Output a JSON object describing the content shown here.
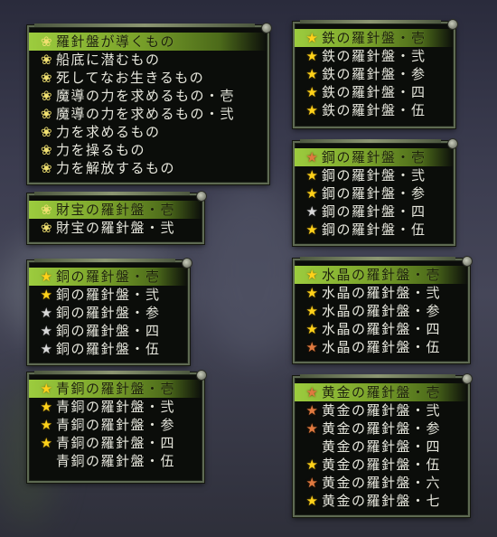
{
  "colors": {
    "selected_row": "#8fbf34",
    "panel_border": "#5e6a52",
    "panel_bg": "#0b0d0a",
    "star_gold": "#ffd21a",
    "star_silver": "#d8d8d8",
    "star_bronze": "#e07a40",
    "flower": "#f0e070"
  },
  "panels": {
    "mission": {
      "items": [
        {
          "label": "羅針盤が導くもの",
          "icon": "flower-icon",
          "selected": true
        },
        {
          "label": "船底に潜むもの",
          "icon": "flower-icon"
        },
        {
          "label": "死してなお生きるもの",
          "icon": "flower-icon"
        },
        {
          "label": "魔導の力を求めるもの・壱",
          "icon": "flower-icon"
        },
        {
          "label": "魔導の力を求めるもの・弐",
          "icon": "flower-icon"
        },
        {
          "label": "力を求めるもの",
          "icon": "flower-icon"
        },
        {
          "label": "力を操るもの",
          "icon": "flower-icon"
        },
        {
          "label": "力を解放するもの",
          "icon": "flower-icon"
        }
      ]
    },
    "zaiho": {
      "items": [
        {
          "label": "財宝の羅針盤・壱",
          "icon": "flower-icon",
          "selected": true
        },
        {
          "label": "財宝の羅針盤・弐",
          "icon": "flower-icon"
        }
      ]
    },
    "do": {
      "items": [
        {
          "label": "銅の羅針盤・壱",
          "icon": "star-gold-icon",
          "selected": true
        },
        {
          "label": "銅の羅針盤・弐",
          "icon": "star-gold-icon"
        },
        {
          "label": "銅の羅針盤・参",
          "icon": "star-silver-icon"
        },
        {
          "label": "銅の羅針盤・四",
          "icon": "star-silver-icon"
        },
        {
          "label": "銅の羅針盤・伍",
          "icon": "star-silver-icon"
        }
      ]
    },
    "seido": {
      "items": [
        {
          "label": "青銅の羅針盤・壱",
          "icon": "star-gold-icon",
          "selected": true
        },
        {
          "label": "青銅の羅針盤・弐",
          "icon": "star-gold-icon"
        },
        {
          "label": "青銅の羅針盤・参",
          "icon": "star-gold-icon"
        },
        {
          "label": "青銅の羅針盤・四",
          "icon": "star-gold-icon"
        },
        {
          "label": "青銅の羅針盤・伍",
          "icon": ""
        }
      ]
    },
    "tetsu": {
      "items": [
        {
          "label": "鉄の羅針盤・壱",
          "icon": "star-gold-icon",
          "selected": true
        },
        {
          "label": "鉄の羅針盤・弐",
          "icon": "star-gold-icon"
        },
        {
          "label": "鉄の羅針盤・参",
          "icon": "star-gold-icon"
        },
        {
          "label": "鉄の羅針盤・四",
          "icon": "star-gold-icon"
        },
        {
          "label": "鉄の羅針盤・伍",
          "icon": "star-gold-icon"
        }
      ]
    },
    "ko": {
      "items": [
        {
          "label": "鋼の羅針盤・壱",
          "icon": "star-bronze-icon",
          "selected": true
        },
        {
          "label": "鋼の羅針盤・弐",
          "icon": "star-gold-icon"
        },
        {
          "label": "鋼の羅針盤・参",
          "icon": "star-gold-icon"
        },
        {
          "label": "鋼の羅針盤・四",
          "icon": "star-silver-icon"
        },
        {
          "label": "鋼の羅針盤・伍",
          "icon": "star-gold-icon"
        }
      ]
    },
    "suisho": {
      "items": [
        {
          "label": "水晶の羅針盤・壱",
          "icon": "star-gold-icon",
          "selected": true
        },
        {
          "label": "水晶の羅針盤・弐",
          "icon": "star-gold-icon"
        },
        {
          "label": "水晶の羅針盤・参",
          "icon": "star-gold-icon"
        },
        {
          "label": "水晶の羅針盤・四",
          "icon": "star-gold-icon"
        },
        {
          "label": "水晶の羅針盤・伍",
          "icon": "star-bronze-icon"
        }
      ]
    },
    "ogon": {
      "items": [
        {
          "label": "黄金の羅針盤・壱",
          "icon": "star-bronze-icon",
          "selected": true
        },
        {
          "label": "黄金の羅針盤・弐",
          "icon": "star-bronze-icon"
        },
        {
          "label": "黄金の羅針盤・参",
          "icon": "star-bronze-icon"
        },
        {
          "label": "黄金の羅針盤・四",
          "icon": ""
        },
        {
          "label": "黄金の羅針盤・伍",
          "icon": "star-gold-icon"
        },
        {
          "label": "黄金の羅針盤・六",
          "icon": "star-bronze-icon"
        },
        {
          "label": "黄金の羅針盤・七",
          "icon": "star-gold-icon"
        }
      ]
    }
  }
}
